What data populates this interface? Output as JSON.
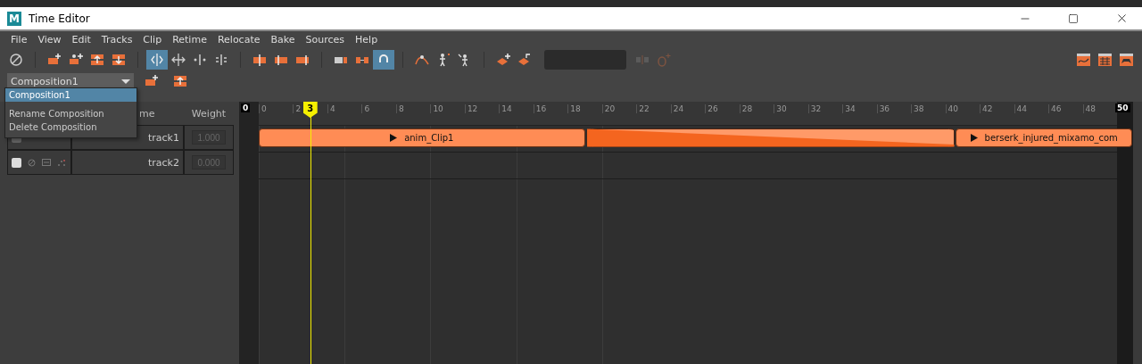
{
  "window": {
    "logo_letter": "M",
    "title": "Time Editor"
  },
  "menu": [
    "File",
    "View",
    "Edit",
    "Tracks",
    "Clip",
    "Retime",
    "Relocate",
    "Bake",
    "Sources",
    "Help"
  ],
  "toolbar": {
    "groups": [
      [
        {
          "active": false,
          "disabled": false
        }
      ],
      [
        {
          "active": false,
          "disabled": false
        },
        {
          "active": false,
          "disabled": false
        },
        {
          "active": false,
          "disabled": false
        },
        {
          "active": false,
          "disabled": false
        }
      ],
      [
        {
          "active": true,
          "disabled": false
        },
        {
          "active": false,
          "disabled": false
        },
        {
          "active": false,
          "disabled": false
        },
        {
          "active": false,
          "disabled": false
        }
      ],
      [
        {
          "active": false,
          "disabled": false
        },
        {
          "active": false,
          "disabled": false
        },
        {
          "active": false,
          "disabled": false
        }
      ],
      [
        {
          "active": false,
          "disabled": false
        },
        {
          "active": false,
          "disabled": false
        },
        {
          "active": true,
          "disabled": false
        }
      ],
      [
        {
          "active": false,
          "disabled": false
        },
        {
          "active": false,
          "disabled": false
        },
        {
          "active": false,
          "disabled": false
        }
      ],
      [
        {
          "active": false,
          "disabled": false
        },
        {
          "active": false,
          "disabled": false
        }
      ]
    ],
    "after_field": [
      {
        "active": false,
        "disabled": true
      },
      {
        "active": false,
        "disabled": true
      }
    ],
    "right": [
      {
        "active": false,
        "disabled": false
      },
      {
        "active": false,
        "disabled": false
      },
      {
        "active": false,
        "disabled": false
      }
    ]
  },
  "composition": {
    "value": "Composition1",
    "tools": [
      {
        "active": false,
        "disabled": false
      },
      {
        "active": false,
        "disabled": false
      }
    ],
    "menu": [
      {
        "label": "Composition1",
        "selected": true
      },
      {
        "label": "Rename Composition",
        "selected": false
      },
      {
        "label": "Delete Composition",
        "selected": false
      }
    ]
  },
  "track_header": {
    "name_visible": "me",
    "weight": "Weight"
  },
  "tracks": [
    {
      "name": "track1",
      "weight": "1.000",
      "enabled": false
    },
    {
      "name": "track2",
      "weight": "0.000",
      "enabled": true
    }
  ],
  "ruler": {
    "start": "0",
    "labels": [
      "0",
      "2",
      "4",
      "6",
      "8",
      "10",
      "12",
      "14",
      "16",
      "18",
      "20",
      "22",
      "24",
      "26",
      "28",
      "30",
      "32",
      "34",
      "36",
      "38",
      "40",
      "42",
      "44",
      "46",
      "48"
    ],
    "end": "50",
    "current": "3"
  },
  "clips": [
    {
      "kind": "clip",
      "name": "anim_Clip1"
    },
    {
      "kind": "blend"
    },
    {
      "kind": "clip",
      "name": "berserk_injured_mixamo_com"
    }
  ]
}
